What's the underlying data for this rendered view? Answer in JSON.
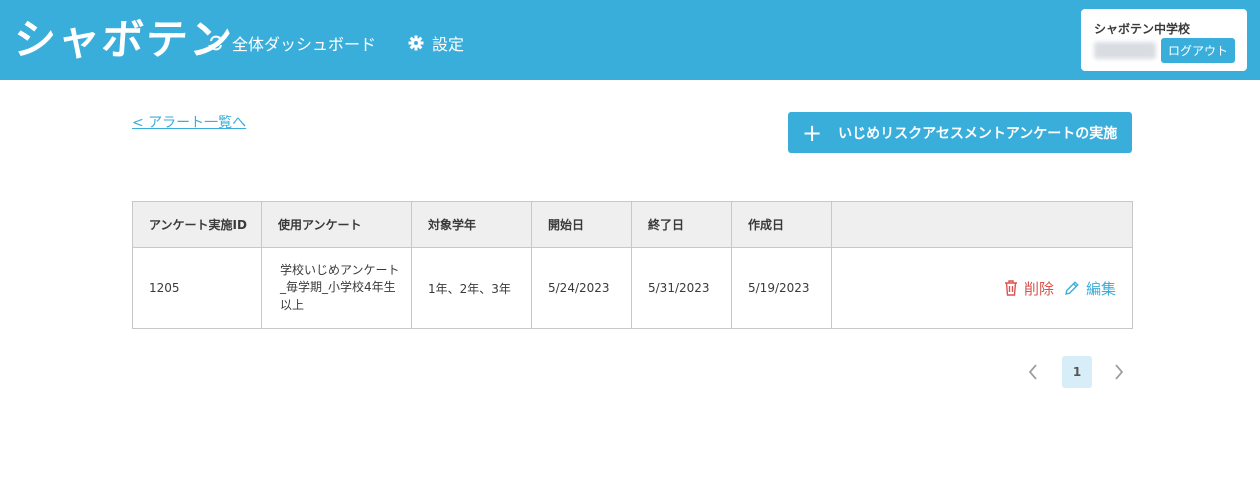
{
  "header": {
    "logo": "シャボテン",
    "nav": [
      {
        "label": "全体ダッシュボード",
        "icon": "sync-icon"
      },
      {
        "label": "設定",
        "icon": "gear-icon"
      }
    ],
    "user": {
      "school": "シャボテン中学校",
      "name": "●●● ●●●",
      "logout_label": "ログアウト"
    },
    "colors": {
      "primary": "#3aaedb",
      "danger": "#d9534f"
    }
  },
  "main": {
    "back_link": "< アラート一覧へ",
    "primary_button": {
      "label": "いじめリスクアセスメントアンケートの実施",
      "icon": "plus-icon"
    },
    "table": {
      "headers": [
        "アンケート実施ID",
        "使用アンケート",
        "対象学年",
        "開始日",
        "終了日",
        "作成日",
        ""
      ],
      "rows": [
        {
          "id": "1205",
          "survey": "学校いじめアンケート_毎学期_小学校4年生以上",
          "grades": "1年、2年、3年",
          "start": "5/24/2023",
          "end": "5/31/2023",
          "created": "5/19/2023",
          "delete_label": "削除",
          "edit_label": "編集"
        }
      ]
    },
    "pagination": {
      "current": "1",
      "prev_icon": "chevron-left-icon",
      "next_icon": "chevron-right-icon"
    }
  }
}
